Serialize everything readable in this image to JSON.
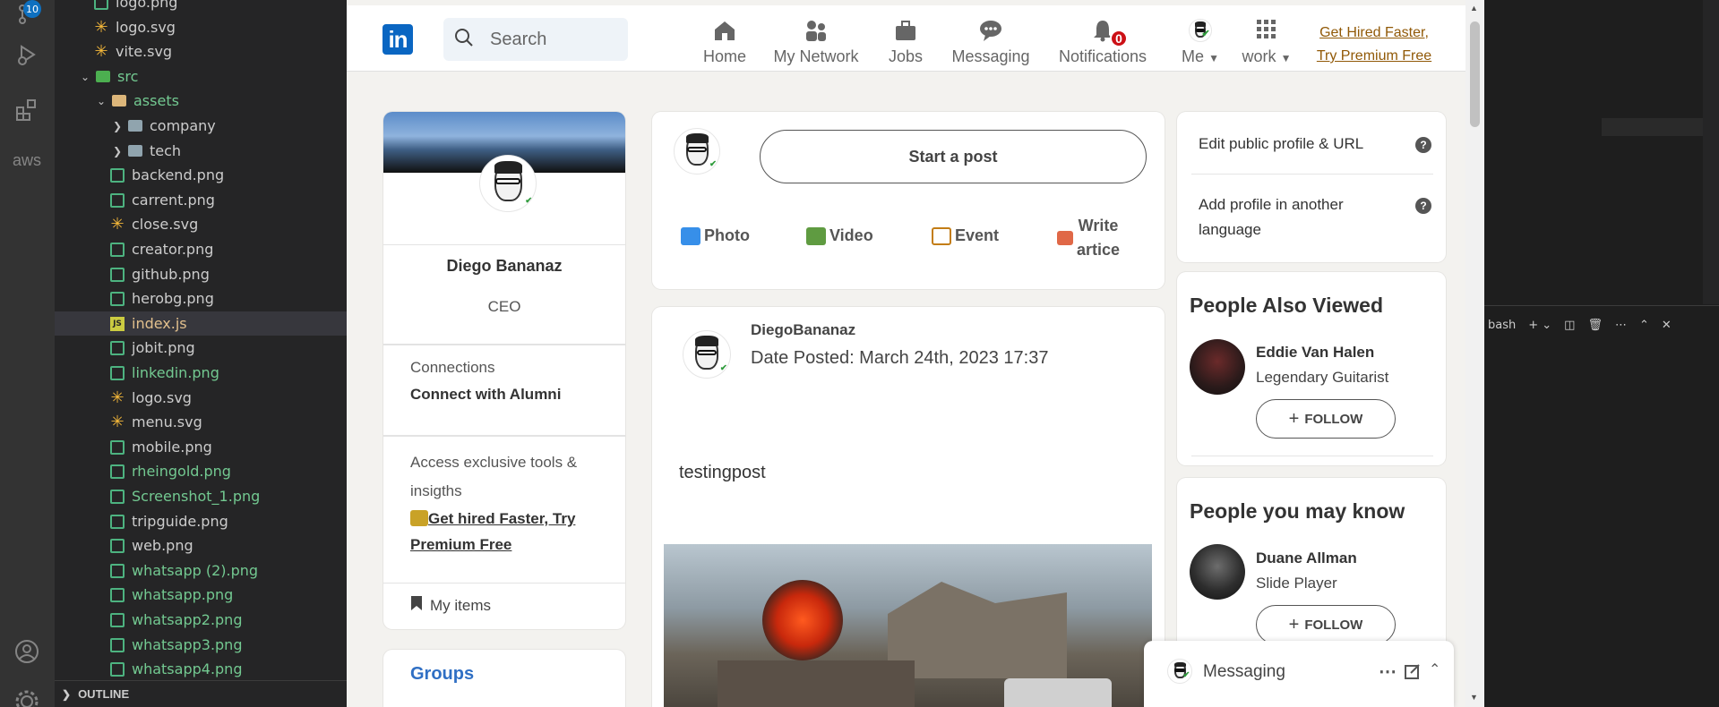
{
  "activity_bar": {
    "source_control_badge": "10",
    "aws_label": "aws"
  },
  "explorer": {
    "items": [
      {
        "label": "logo.png",
        "kind": "img",
        "indent": 2,
        "color": "#cccccc"
      },
      {
        "label": "logo.svg",
        "kind": "svg",
        "indent": 2,
        "color": "#cccccc"
      },
      {
        "label": "vite.svg",
        "kind": "svg",
        "indent": 2,
        "color": "#cccccc"
      },
      {
        "label": "src",
        "kind": "srcfolder",
        "indent": 1,
        "color": "#73c991",
        "chev": "open"
      },
      {
        "label": "assets",
        "kind": "folderopen",
        "indent": 2,
        "color": "#73c991",
        "chev": "open"
      },
      {
        "label": "company",
        "kind": "folder",
        "indent": 3,
        "color": "#cccccc",
        "chev": "closed"
      },
      {
        "label": "tech",
        "kind": "folder",
        "indent": 3,
        "color": "#cccccc",
        "chev": "closed"
      },
      {
        "label": "backend.png",
        "kind": "img",
        "indent": 3,
        "color": "#cccccc"
      },
      {
        "label": "carrent.png",
        "kind": "img",
        "indent": 3,
        "color": "#cccccc"
      },
      {
        "label": "close.svg",
        "kind": "svg",
        "indent": 3,
        "color": "#cccccc"
      },
      {
        "label": "creator.png",
        "kind": "img",
        "indent": 3,
        "color": "#cccccc"
      },
      {
        "label": "github.png",
        "kind": "img",
        "indent": 3,
        "color": "#cccccc"
      },
      {
        "label": "herobg.png",
        "kind": "img",
        "indent": 3,
        "color": "#cccccc"
      },
      {
        "label": "index.js",
        "kind": "js",
        "indent": 3,
        "color": "#e2c08d",
        "selected": true
      },
      {
        "label": "jobit.png",
        "kind": "img",
        "indent": 3,
        "color": "#cccccc"
      },
      {
        "label": "linkedin.png",
        "kind": "img",
        "indent": 3,
        "color": "#73c991"
      },
      {
        "label": "logo.svg",
        "kind": "svg",
        "indent": 3,
        "color": "#cccccc"
      },
      {
        "label": "menu.svg",
        "kind": "svg",
        "indent": 3,
        "color": "#cccccc"
      },
      {
        "label": "mobile.png",
        "kind": "img",
        "indent": 3,
        "color": "#cccccc"
      },
      {
        "label": "rheingold.png",
        "kind": "img",
        "indent": 3,
        "color": "#73c991"
      },
      {
        "label": "Screenshot_1.png",
        "kind": "img",
        "indent": 3,
        "color": "#73c991"
      },
      {
        "label": "tripguide.png",
        "kind": "img",
        "indent": 3,
        "color": "#cccccc"
      },
      {
        "label": "web.png",
        "kind": "img",
        "indent": 3,
        "color": "#cccccc"
      },
      {
        "label": "whatsapp (2).png",
        "kind": "img",
        "indent": 3,
        "color": "#73c991"
      },
      {
        "label": "whatsapp.png",
        "kind": "img",
        "indent": 3,
        "color": "#73c991"
      },
      {
        "label": "whatsapp2.png",
        "kind": "img",
        "indent": 3,
        "color": "#73c991"
      },
      {
        "label": "whatsapp3.png",
        "kind": "img",
        "indent": 3,
        "color": "#73c991"
      },
      {
        "label": "whatsapp4.png",
        "kind": "img",
        "indent": 3,
        "color": "#73c991"
      }
    ],
    "outline_label": "OUTLINE"
  },
  "terminal": {
    "shell_label": "bash"
  },
  "linkedin": {
    "header": {
      "logo_text": "in",
      "search_placeholder": "Search",
      "nav": [
        {
          "label": "Home",
          "icon": "home-icon"
        },
        {
          "label": "My Network",
          "icon": "network-icon"
        },
        {
          "label": "Jobs",
          "icon": "briefcase-icon"
        },
        {
          "label": "Messaging",
          "icon": "chat-icon"
        },
        {
          "label": "Notifications",
          "icon": "bell-icon"
        }
      ],
      "notifications_count": "0",
      "me_label": "Me",
      "work_label": "work",
      "premium_line1": "Get Hired Faster,",
      "premium_line2": "Try Premium Free"
    },
    "profile": {
      "name": "Diego Bananaz",
      "title": "CEO",
      "connections_label": "Connections",
      "connections_cta": "Connect with Alumni",
      "access_text": "Access exclusive tools & insigths",
      "premium_cta": "Get hired Faster, Try Premium Free",
      "my_items": "My items",
      "groups": "Groups"
    },
    "share_box": {
      "start_post": "Start a post",
      "photo": "Photo",
      "video": "Video",
      "event": "Event",
      "write_line1": "Write",
      "write_line2": "artice"
    },
    "post": {
      "author": "DiegoBananaz",
      "date": "Date Posted: March 24th, 2023 17:37",
      "body": "testingpost"
    },
    "right": {
      "edit_profile": "Edit public profile & URL",
      "add_language": "Add profile in another language",
      "people_also_viewed": "People Also Viewed",
      "pav_name": "Eddie Van Halen",
      "pav_role": "Legendary Guitarist",
      "follow": "FOLLOW",
      "people_may_know": "People you may know",
      "pymk_name": "Duane Allman",
      "pymk_role": "Slide Player"
    },
    "messaging_dock": {
      "label": "Messaging"
    }
  },
  "colors": {
    "linkedin_blue": "#0a66c2",
    "premium_gold": "#915907",
    "notification_red": "#cc1016",
    "vscode_git_green": "#73c991"
  }
}
